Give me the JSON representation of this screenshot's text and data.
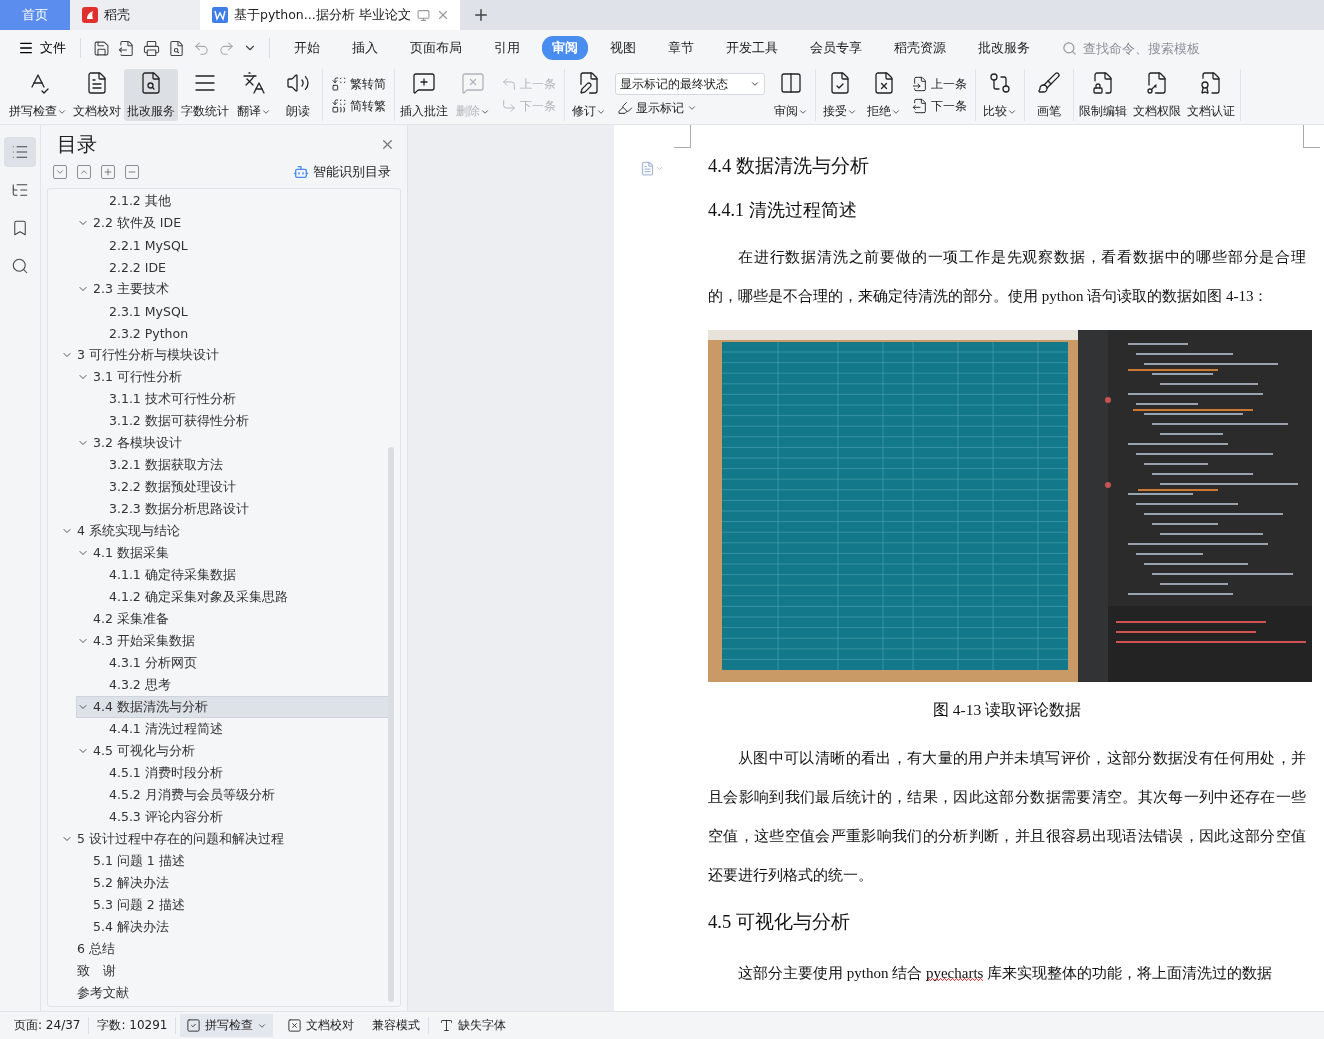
{
  "tabs": [
    {
      "label": "首页",
      "kind": "home",
      "selected": false
    },
    {
      "label": "稻壳",
      "kind": "app",
      "selected": false
    },
    {
      "label": "基于python...据分析 毕业论文",
      "kind": "doc",
      "selected": true
    }
  ],
  "menu": {
    "file": "文件",
    "items": [
      {
        "label": "开始",
        "selected": false
      },
      {
        "label": "插入",
        "selected": false
      },
      {
        "label": "页面布局",
        "selected": false
      },
      {
        "label": "引用",
        "selected": false
      },
      {
        "label": "审阅",
        "selected": true
      },
      {
        "label": "视图",
        "selected": false
      },
      {
        "label": "章节",
        "selected": false
      },
      {
        "label": "开发工具",
        "selected": false
      },
      {
        "label": "会员专享",
        "selected": false
      },
      {
        "label": "稻壳资源",
        "selected": false
      },
      {
        "label": "批改服务",
        "selected": false
      }
    ],
    "search": {
      "placeholder": "查找命令、搜索模板"
    }
  },
  "ribbon": [
    {
      "items": [
        {
          "kind": "large",
          "label": "拼写检查",
          "dropdown": true,
          "disabled": false,
          "pressed": false
        },
        {
          "kind": "large",
          "label": "文档校对",
          "dropdown": false,
          "disabled": false,
          "pressed": false
        },
        {
          "kind": "large",
          "label": "批改服务",
          "dropdown": false,
          "disabled": false,
          "pressed": true
        },
        {
          "kind": "large",
          "label": "字数统计",
          "dropdown": false,
          "disabled": false,
          "pressed": false
        },
        {
          "kind": "large",
          "label": "翻译",
          "dropdown": true,
          "disabled": false,
          "pressed": false
        },
        {
          "kind": "large",
          "label": "朗读",
          "dropdown": false,
          "disabled": false,
          "pressed": false
        }
      ]
    },
    {
      "items": [
        {
          "kind": "stack",
          "rows": [
            {
              "label": "繁转简",
              "disabled": false
            },
            {
              "label": "简转繁",
              "disabled": false
            }
          ]
        }
      ]
    },
    {
      "items": [
        {
          "kind": "large",
          "label": "插入批注",
          "dropdown": false,
          "disabled": false,
          "pressed": false
        },
        {
          "kind": "large",
          "label": "删除",
          "dropdown": true,
          "disabled": true,
          "pressed": false
        },
        {
          "kind": "stack",
          "rows": [
            {
              "label": "上一条",
              "disabled": true
            },
            {
              "label": "下一条",
              "disabled": true
            }
          ]
        }
      ]
    },
    {
      "items": [
        {
          "kind": "large",
          "label": "修订",
          "dropdown": true,
          "disabled": false,
          "pressed": false
        },
        {
          "kind": "select",
          "value": "显示标记的最终状态",
          "below": {
            "label": "显示标记",
            "dropdown": true
          }
        },
        {
          "kind": "large",
          "label": "审阅",
          "dropdown": true,
          "disabled": false,
          "pressed": false
        }
      ]
    },
    {
      "items": [
        {
          "kind": "large",
          "label": "接受",
          "dropdown": true,
          "disabled": false,
          "pressed": false
        },
        {
          "kind": "large",
          "label": "拒绝",
          "dropdown": true,
          "disabled": false,
          "pressed": false
        },
        {
          "kind": "stack",
          "rows": [
            {
              "label": "上一条",
              "disabled": false
            },
            {
              "label": "下一条",
              "disabled": false
            }
          ]
        }
      ]
    },
    {
      "items": [
        {
          "kind": "large",
          "label": "比较",
          "dropdown": true,
          "disabled": false,
          "pressed": false
        }
      ]
    },
    {
      "items": [
        {
          "kind": "large",
          "label": "画笔",
          "dropdown": false,
          "disabled": false,
          "pressed": false
        }
      ]
    },
    {
      "items": [
        {
          "kind": "large",
          "label": "限制编辑",
          "dropdown": false,
          "disabled": false,
          "pressed": false
        },
        {
          "kind": "large",
          "label": "文档权限",
          "dropdown": false,
          "disabled": false,
          "pressed": false
        },
        {
          "kind": "large",
          "label": "文档认证",
          "dropdown": false,
          "disabled": false,
          "pressed": false
        }
      ]
    }
  ],
  "sidebar": {
    "items": [
      {
        "kind": "toc",
        "selected": true
      },
      {
        "kind": "outline",
        "selected": false
      },
      {
        "kind": "bookmark",
        "selected": false
      },
      {
        "kind": "search",
        "selected": false
      }
    ]
  },
  "toc": {
    "title": "目录",
    "smart_button": "智能识别目录",
    "items": [
      {
        "children": [
          {
            "children": [
              {
                "label": "2.1.2 其他",
                "selected": false
              }
            ]
          },
          {
            "label": "2.2 软件及 IDE",
            "selected": false,
            "expanded": true,
            "children": [
              {
                "label": "2.2.1 MySQL",
                "selected": false
              },
              {
                "label": "2.2.2 IDE",
                "selected": false
              }
            ]
          },
          {
            "label": "2.3 主要技术",
            "selected": false,
            "expanded": true,
            "children": [
              {
                "label": "2.3.1 MySQL",
                "selected": false
              },
              {
                "label": "2.3.2 Python",
                "selected": false
              }
            ]
          }
        ]
      },
      {
        "label": "3  可行性分析与模块设计",
        "selected": false,
        "expanded": true,
        "children": [
          {
            "label": "3.1  可行性分析",
            "selected": false,
            "expanded": true,
            "children": [
              {
                "label": "3.1.1  技术可行性分析",
                "selected": false
              },
              {
                "label": "3.1.2  数据可获得性分析",
                "selected": false
              }
            ]
          },
          {
            "label": "3.2  各模块设计",
            "selected": false,
            "expanded": true,
            "children": [
              {
                "label": "3.2.1  数据获取方法",
                "selected": false
              },
              {
                "label": "3.2.2  数据预处理设计",
                "selected": false
              },
              {
                "label": "3.2.3  数据分析思路设计",
                "selected": false
              }
            ]
          }
        ]
      },
      {
        "label": "4  系统实现与结论",
        "selected": false,
        "expanded": true,
        "children": [
          {
            "label": "4.1 数据采集",
            "selected": false,
            "expanded": true,
            "children": [
              {
                "label": "4.1.1 确定待采集数据",
                "selected": false
              },
              {
                "label": "4.1.2 确定采集对象及采集思路",
                "selected": false
              }
            ]
          },
          {
            "label": "4.2 采集准备",
            "selected": false
          },
          {
            "label": "4.3 开始采集数据",
            "selected": false,
            "expanded": true,
            "children": [
              {
                "label": "4.3.1 分析网页",
                "selected": false
              },
              {
                "label": "4.3.2 思考",
                "selected": false
              }
            ]
          },
          {
            "label": "4.4 数据清洗与分析",
            "selected": true,
            "expanded": true,
            "children": [
              {
                "label": "4.4.1 清洗过程简述",
                "selected": false
              }
            ]
          },
          {
            "label": "4.5  可视化与分析",
            "selected": false,
            "expanded": true,
            "children": [
              {
                "label": "4.5.1 消费时段分析",
                "selected": false
              },
              {
                "label": "4.5.2 月消费与会员等级分析",
                "selected": false
              },
              {
                "label": "4.5.3 评论内容分析",
                "selected": false
              }
            ]
          }
        ]
      },
      {
        "label": "5  设计过程中存在的问题和解决过程",
        "selected": false,
        "expanded": true,
        "children": [
          {
            "label": "5.1 问题 1 描述",
            "selected": false
          },
          {
            "label": "5.2 解决办法",
            "selected": false
          },
          {
            "label": "5.3 问题 2 描述",
            "selected": false
          },
          {
            "label": "5.4 解决办法",
            "selected": false
          }
        ]
      },
      {
        "label": "6  总结",
        "selected": false
      },
      {
        "label": "致　谢",
        "selected": false
      },
      {
        "label": "参考文献",
        "selected": false
      }
    ]
  },
  "document": {
    "blocks": [
      {
        "kind": "heading2",
        "text": "4.4 数据清洗与分析"
      },
      {
        "kind": "heading3",
        "text": "4.4.1 清洗过程简述"
      },
      {
        "kind": "paragraph",
        "runs": [
          {
            "text": "在进行数据清洗之前要做的一项工作是先观察数据，看看数据中的哪些部分是合理的，哪些是不合理的，来确定待清洗的部分。使用 python 语句读取的数据如图 4-13：",
            "misspelled": false
          }
        ]
      },
      {
        "kind": "figure"
      },
      {
        "kind": "caption",
        "text": "图 4-13  读取评论数据"
      },
      {
        "kind": "paragraph",
        "runs": [
          {
            "text": "从图中可以清晰的看出，有大量的用户并未填写评价，这部分数据没有任何用处，并且会影响到我们最后统计的，结果，因此这部分数据需要清空。其次每一列中还存在一些空值，这些空值会严重影响我们的分析判断，并且很容易出现语法错误，因此这部分空值还要进行列格式的统一。",
            "misspelled": false
          }
        ]
      },
      {
        "kind": "heading2",
        "text": "4.5  可视化与分析"
      },
      {
        "kind": "paragraph",
        "runs": [
          {
            "text": "这部分主要使用 python 结合 ",
            "misspelled": false
          },
          {
            "text": "pyecharts",
            "misspelled": true
          },
          {
            "text": " 库来实现整体的功能，将上面清洗过的数据",
            "misspelled": false
          }
        ]
      }
    ]
  },
  "status_bar": [
    {
      "kind": "text",
      "label": "页面: 24/37"
    },
    {
      "kind": "text",
      "label": "字数: 10291"
    },
    {
      "kind": "toggle",
      "label": "拼写检查",
      "selected": true,
      "dropdown": true
    },
    {
      "kind": "button",
      "label": "文档校对"
    },
    {
      "kind": "text",
      "label": "兼容模式"
    },
    {
      "kind": "font",
      "label": "缺失字体"
    }
  ]
}
